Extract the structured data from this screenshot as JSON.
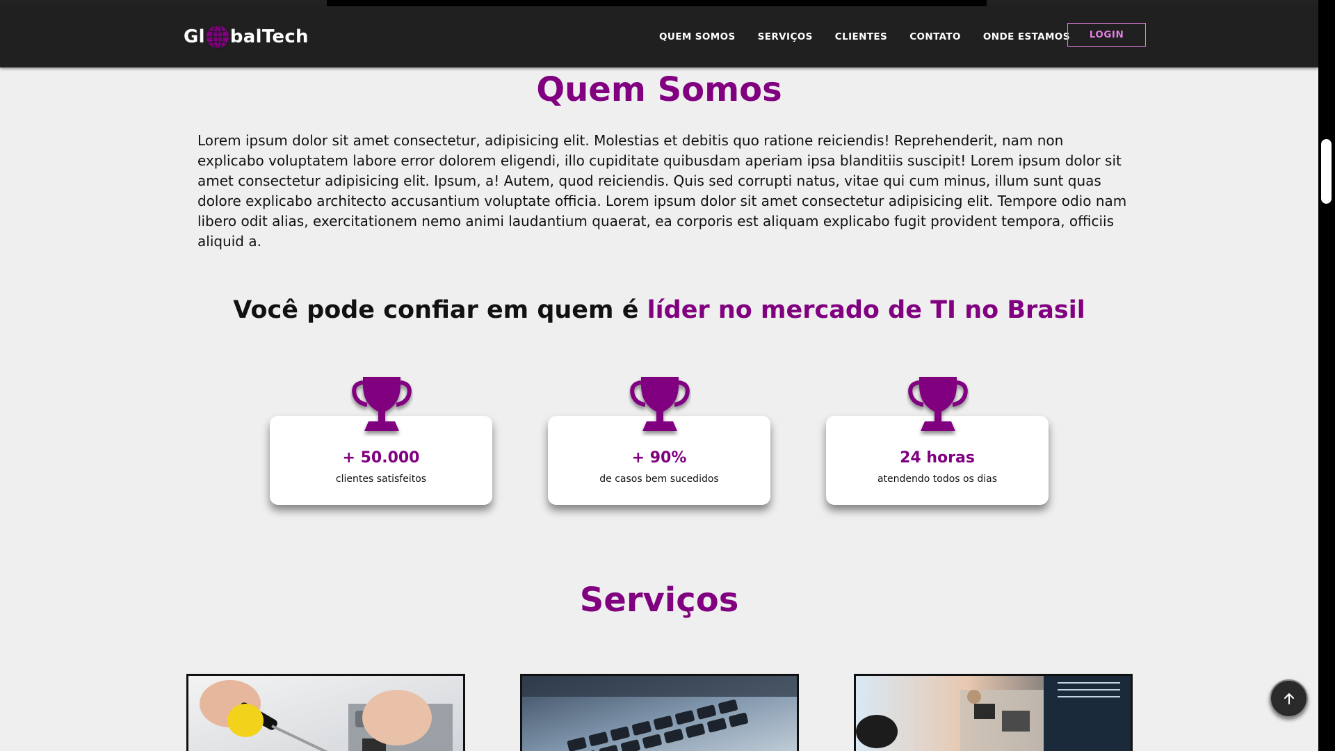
{
  "brand": {
    "prefix": "Gl",
    "suffix": "balTech",
    "accent": "#800080"
  },
  "nav": {
    "items": [
      {
        "label": "QUEM SOMOS"
      },
      {
        "label": "SERVIÇOS"
      },
      {
        "label": "CLIENTES"
      },
      {
        "label": "CONTATO"
      },
      {
        "label": "ONDE ESTAMOS"
      }
    ],
    "login_label": "LOGIN"
  },
  "about": {
    "title": "Quem Somos",
    "text": "Lorem ipsum dolor sit amet consectetur, adipisicing elit. Molestias et debitis quo ratione reiciendis! Reprehenderit, nam non explicabo voluptatem labore error dolorem eligendi, illo cupiditate quibusdam aperiam ipsa blanditiis suscipit! Lorem ipsum dolor sit amet consectetur adipisicing elit. Ipsum, a! Autem, quod reiciendis. Quis sed corrupti natus, vitae qui cum minus, illum sunt quas dolore explicabo architecto accusantium voluptate officia. Lorem ipsum dolor sit amet consectetur adipisicing elit. Tempore odio nam libero odit alias, exercitationem nemo animi laudantium quaerat, ea corporis est aliquam explicabo fugit provident tempora, officiis aliquid a."
  },
  "leader": {
    "prefix": "Você pode confiar em quem é",
    "highlight": "líder no mercado de TI no Brasil"
  },
  "stats": [
    {
      "value": "+ 50.000",
      "label": "clientes satisfeitos",
      "icon": "trophy-icon"
    },
    {
      "value": "+ 90%",
      "label": "de casos bem sucedidos",
      "icon": "trophy-icon"
    },
    {
      "value": "24 horas",
      "label": "atendendo todos os dias",
      "icon": "trophy-icon"
    }
  ],
  "services": {
    "title": "Serviços",
    "images": [
      "hardware-repair-image",
      "laptop-keyboard-image",
      "circuit-board-image"
    ]
  },
  "back_to_top": {
    "icon": "arrow-up-icon"
  }
}
